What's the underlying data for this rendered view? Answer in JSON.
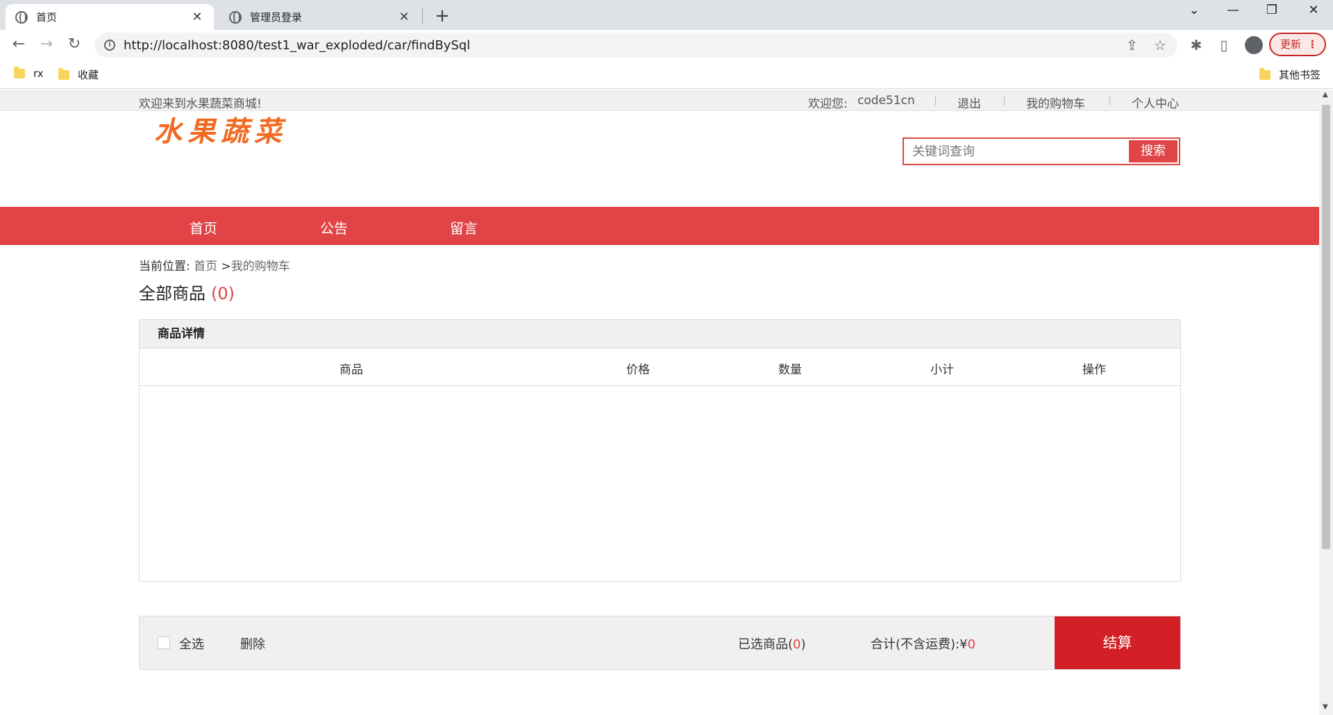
{
  "browser": {
    "tabs": [
      {
        "title": "首页"
      },
      {
        "title": "管理员登录"
      }
    ],
    "url": "http://localhost:8080/test1_war_exploded/car/findBySql",
    "update_label": "更新",
    "bookmarks": [
      "rx",
      "收藏"
    ],
    "other_bookmarks": "其他书签"
  },
  "site": {
    "welcome": "欢迎来到水果蔬菜商城!",
    "user_greeting": "欢迎您:",
    "username": "code51cn",
    "links": [
      "退出",
      "我的购物车",
      "个人中心"
    ],
    "logo_text": "水果蔬菜",
    "search_placeholder": "关键词查询",
    "search_button": "搜索",
    "nav": [
      "首页",
      "公告",
      "留言"
    ]
  },
  "breadcrumb": {
    "label": "当前位置:",
    "home": "首页",
    "sep": " >",
    "current": "我的购物车"
  },
  "cart": {
    "heading": "全部商品",
    "count": "(0)",
    "section_title": "商品详情",
    "columns": [
      "商品",
      "价格",
      "数量",
      "小计",
      "操作"
    ],
    "select_all": "全选",
    "delete": "删除",
    "selected_label": "已选商品(",
    "selected_count": "0",
    "selected_close": ")",
    "total_label": "合计(不含运费):",
    "currency": "¥",
    "total_value": "0",
    "checkout": "结算"
  }
}
